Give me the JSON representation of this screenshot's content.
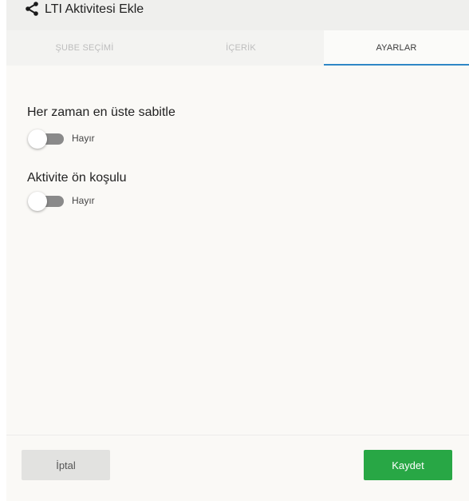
{
  "header": {
    "title": "LTI Aktivitesi Ekle",
    "icon": "share-icon"
  },
  "tabs": [
    {
      "label": "ŞUBE SEÇİMİ",
      "active": false
    },
    {
      "label": "İÇERİK",
      "active": false
    },
    {
      "label": "AYARLAR",
      "active": true
    }
  ],
  "settings": [
    {
      "title": "Her zaman en üste sabitle",
      "toggle_label": "Hayır",
      "on": false
    },
    {
      "title": "Aktivite ön koşulu",
      "toggle_label": "Hayır",
      "on": false
    }
  ],
  "footer": {
    "cancel_label": "İptal",
    "save_label": "Kaydet"
  },
  "colors": {
    "accent_tab": "#2f87c6",
    "save_button": "#28a745",
    "toggle_off": "#8a8a8a"
  }
}
